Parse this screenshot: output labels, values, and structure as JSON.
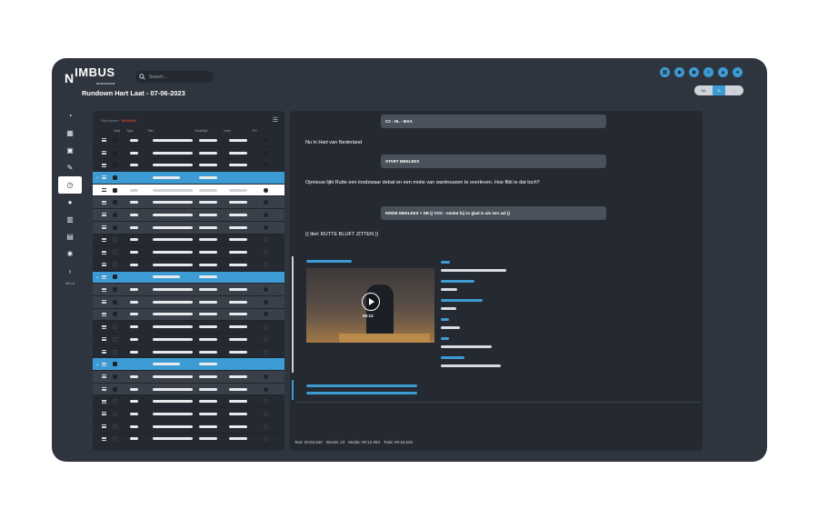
{
  "app": {
    "logo_mark": "N",
    "logo_name": "IMBUS",
    "logo_sub": "NEWSROOM",
    "page_title": "Rundown Hart Laat - 07-06-2023",
    "version": "v2.1.4"
  },
  "search": {
    "placeholder": "Search..."
  },
  "top_icons": [
    "grid-icon",
    "tag-icon",
    "tag-icon",
    "list-icon",
    "bell-icon",
    "user-icon"
  ],
  "mini_buttons": [
    "AA",
    "sync",
    "back"
  ],
  "sidebar": {
    "items": [
      {
        "icon": "dashboard-icon",
        "glyph": "◔"
      },
      {
        "icon": "calendar-grid-icon",
        "glyph": "▦"
      },
      {
        "icon": "calendar-icon",
        "glyph": "▣"
      },
      {
        "icon": "edit-icon",
        "glyph": "✎"
      },
      {
        "icon": "clock-icon",
        "glyph": "◷",
        "active": true
      },
      {
        "icon": "user-icon",
        "glyph": "●"
      },
      {
        "icon": "building-icon",
        "glyph": "▥"
      },
      {
        "icon": "document-icon",
        "glyph": "▤"
      },
      {
        "icon": "gear-icon",
        "glyph": "✱"
      },
      {
        "icon": "chevron-right-icon",
        "glyph": "›"
      }
    ]
  },
  "rundown": {
    "duration_label": "Duur/Index",
    "duration_value": "00:03:46",
    "columns": [
      "Hold",
      "Type",
      "Titel",
      "Tekstblijd",
      "Lees",
      "RC"
    ],
    "rows": [
      {
        "kind": "normal",
        "hold": "dark",
        "circle": "dark"
      },
      {
        "kind": "normal",
        "hold": "dark",
        "circle": "dark"
      },
      {
        "kind": "normal",
        "hold": "dark",
        "circle": "dark"
      },
      {
        "kind": "group"
      },
      {
        "kind": "selected",
        "hold": "dark",
        "circle": "dark"
      },
      {
        "kind": "dark",
        "hold": "dark",
        "circle": "dark"
      },
      {
        "kind": "dark",
        "hold": "dark",
        "circle": "dark"
      },
      {
        "kind": "dark",
        "hold": "dark",
        "circle": "dark"
      },
      {
        "kind": "normal",
        "hold": "outline",
        "circle": "outline"
      },
      {
        "kind": "normal",
        "hold": "outline",
        "circle": "outline"
      },
      {
        "kind": "normal",
        "hold": "outline",
        "circle": "outline"
      },
      {
        "kind": "group"
      },
      {
        "kind": "dark",
        "hold": "dark",
        "circle": "dark"
      },
      {
        "kind": "dark",
        "hold": "dark",
        "circle": "dark"
      },
      {
        "kind": "dark",
        "hold": "dark",
        "circle": "dark"
      },
      {
        "kind": "normal",
        "hold": "outline",
        "circle": "outline"
      },
      {
        "kind": "normal",
        "hold": "outline",
        "circle": "outline"
      },
      {
        "kind": "normal",
        "hold": "outline",
        "circle": "outline"
      },
      {
        "kind": "group"
      },
      {
        "kind": "dark",
        "hold": "dark",
        "circle": "dark"
      },
      {
        "kind": "dark",
        "hold": "dark",
        "circle": "dark"
      },
      {
        "kind": "normal",
        "hold": "outline",
        "circle": "outline"
      },
      {
        "kind": "normal",
        "hold": "outline",
        "circle": "outline"
      },
      {
        "kind": "normal",
        "hold": "outline",
        "circle": "outline"
      },
      {
        "kind": "normal",
        "hold": "outline",
        "circle": "outline"
      }
    ]
  },
  "script": {
    "tag1": "C2 - HL - MAA",
    "line1": "Nu in Hart van Nederland",
    "tag2": "START MEELEES",
    "line2": "Opnieuw lijkt Rutte een loodzwaar debat en een motie van wantrouwen te overleven. Hoe flikt ie dat toch?",
    "tag3": "EINDE MEELEES + SB (( VOX - omdat hij zo glad is als een aal ))",
    "line3": "(( titel: RUTTE BLIJFT ZITTEN ))",
    "video_time": "00:13"
  },
  "status": {
    "text": "Text: 00:03.540",
    "words": "Words: 23",
    "media": "Media: 00:12.083",
    "total": "Total: 00:16.525"
  },
  "colors": {
    "accent": "#3d9bd4",
    "danger": "#e8412f",
    "frame": "#2f353f",
    "panel": "#252a32"
  }
}
